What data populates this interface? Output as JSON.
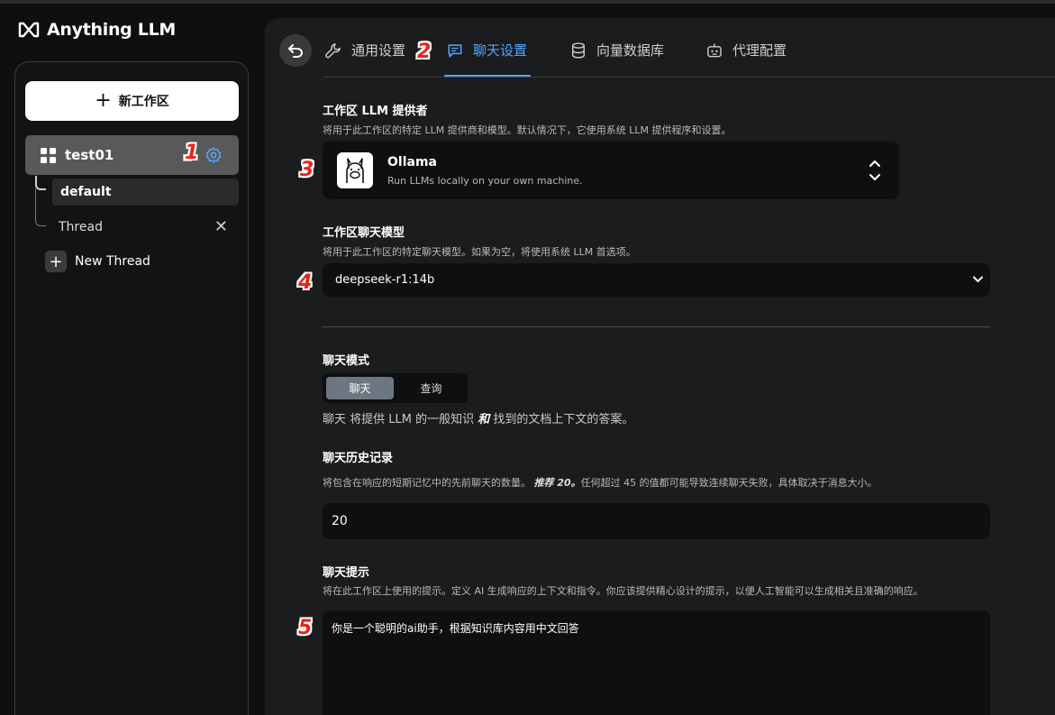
{
  "app": {
    "brand": "Anything LLM"
  },
  "sidebar": {
    "new_workspace_label": "新工作区",
    "workspace": {
      "name": "test01"
    },
    "threads": [
      {
        "label": "default"
      },
      {
        "label": "Thread"
      }
    ],
    "new_thread_label": "New Thread"
  },
  "tabs": [
    {
      "label": "通用设置",
      "active": false,
      "icon": "wrench-icon"
    },
    {
      "label": "聊天设置",
      "active": true,
      "icon": "chat-icon"
    },
    {
      "label": "向量数据库",
      "active": false,
      "icon": "database-icon"
    },
    {
      "label": "代理配置",
      "active": false,
      "icon": "robot-icon"
    }
  ],
  "provider_section": {
    "title": "工作区 LLM 提供者",
    "desc": "将用于此工作区的特定 LLM 提供商和模型。默认情况下，它使用系统 LLM 提供程序和设置。",
    "provider_name": "Ollama",
    "provider_desc": "Run LLMs locally on your own machine."
  },
  "model_section": {
    "title": "工作区聊天模型",
    "desc": "将用于此工作区的特定聊天模型。如果为空，将使用系统 LLM 首选项。",
    "selected": "deepseek-r1:14b"
  },
  "mode_section": {
    "title": "聊天模式",
    "options": [
      "聊天",
      "查询"
    ],
    "selected": "聊天",
    "desc_prefix": "聊天",
    "desc_mid": " 将提供 LLM 的一般知识 ",
    "desc_em": "和",
    "desc_suffix": " 找到的文档上下文的答案。"
  },
  "history_section": {
    "title": "聊天历史记录",
    "desc_before": "将包含在响应的短期记忆中的先前聊天的数量。",
    "desc_em": "推荐 20。",
    "desc_after": "任何超过 45 的值都可能导致连续聊天失败，具体取决于消息大小。",
    "value": "20"
  },
  "prompt_section": {
    "title": "聊天提示",
    "desc": "将在此工作区上使用的提示。定义 AI 生成响应的上下文和指令。你应该提供精心设计的提示，以便人工智能可以生成相关且准确的响应。",
    "value": "你是一个聪明的ai助手，根据知识库内容用中文回答"
  },
  "annotations": [
    "1",
    "2",
    "3",
    "4",
    "5"
  ],
  "colors": {
    "accent": "#52a8ff",
    "annotation": "#e8231c",
    "panel": "#1b1c1d",
    "background": "#0e0f0f"
  }
}
